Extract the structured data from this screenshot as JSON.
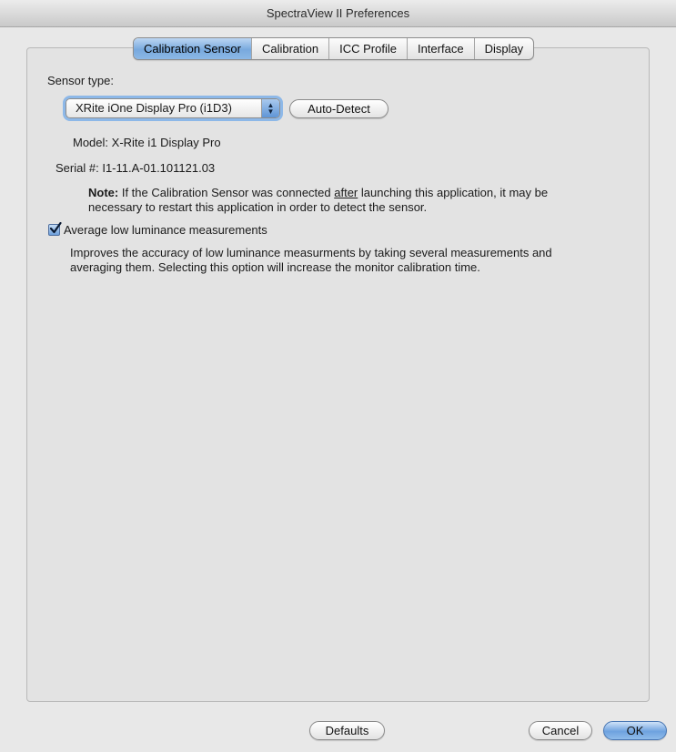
{
  "window": {
    "title": "SpectraView II Preferences"
  },
  "tabs": [
    {
      "label": "Calibration Sensor",
      "active": true
    },
    {
      "label": "Calibration",
      "active": false
    },
    {
      "label": "ICC Profile",
      "active": false
    },
    {
      "label": "Interface",
      "active": false
    },
    {
      "label": "Display",
      "active": false
    }
  ],
  "sensor": {
    "type_label": "Sensor type:",
    "selected_sensor": "XRite iOne Display Pro (i1D3)",
    "auto_detect_label": "Auto-Detect",
    "model_label": "Model:",
    "model_value": "X-Rite i1 Display Pro",
    "serial_label": "Serial #:",
    "serial_value": "I1-11.A-01.101121.03",
    "note_bold": "Note:",
    "note_part1": " If the Calibration Sensor was connected ",
    "note_underlined": "after",
    "note_part2": " launching this application, it may be",
    "note_line2": "necessary to restart this application in order to detect the sensor."
  },
  "average": {
    "checked": true,
    "label": "Average low luminance measurements",
    "description_line1": "Improves the accuracy of low luminance measurments by taking several measurements and",
    "description_line2": "averaging them. Selecting this option will increase the monitor calibration time."
  },
  "footer": {
    "defaults_label": "Defaults",
    "cancel_label": "Cancel",
    "ok_label": "OK"
  },
  "colors": {
    "accent": "#6ea2df",
    "window_bg": "#e8e8e8"
  }
}
